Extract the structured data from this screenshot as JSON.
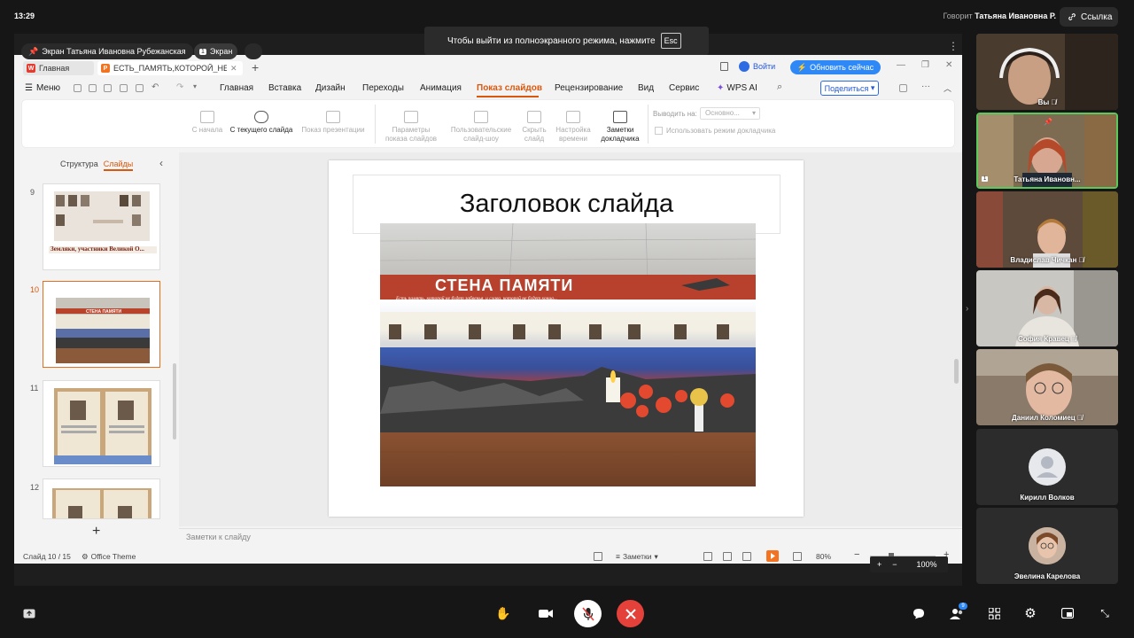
{
  "topbar": {
    "clock": "13:29",
    "speaking_label": "Говорит",
    "speaking_name": "Татьяна Ивановна Р.",
    "link_label": "Ссылка"
  },
  "share": {
    "presenter_label": "Экран Татьяна Ивановна Рубежанская",
    "screen_badge": "Экран",
    "screen_badge_num": "1",
    "fullscreen_tip": "Чтобы выйти из полноэкранного режима, нажмите",
    "fullscreen_key": "Esc"
  },
  "wps": {
    "tab_home": "Главная",
    "tab_doc": "ЕСТЬ_ПАМЯТЬ,КОТОРОЙ_НЕ",
    "login": "Войти",
    "update": "Обновить сейчас",
    "menu_label": "Меню",
    "menu": [
      "Главная",
      "Вставка",
      "Дизайн",
      "Переходы",
      "Анимация",
      "Показ слайдов",
      "Рецензирование",
      "Вид",
      "Сервис",
      "WPS AI"
    ],
    "share_btn": "Поделиться",
    "ribbon": {
      "from_start": "С начала",
      "from_current": "С текущего слайда",
      "present": "Показ презентации",
      "settings_1": "Параметры",
      "settings_2": "показа слайдов",
      "custom_1": "Пользовательские",
      "custom_2": "слайд-шоу",
      "hide_1": "Скрыть",
      "hide_2": "слайд",
      "timing_1": "Настройка",
      "timing_2": "времени",
      "notes_1": "Заметки",
      "notes_2": "докладчика",
      "output_label": "Выводить на:",
      "output_value": "Основно...",
      "presenter_mode": "Использовать режим докладчика"
    },
    "left_tabs": [
      "Структура",
      "Слайды"
    ],
    "thumbs": [
      {
        "num": "9",
        "caption": "Земляки, участники Великой О..."
      },
      {
        "num": "10",
        "caption": "СТЕНА ПАМЯТИ"
      },
      {
        "num": "11",
        "caption": ""
      },
      {
        "num": "12",
        "caption": ""
      }
    ],
    "add_slide": "+",
    "slide_title": "Заголовок слайда",
    "photo_banner": "СТЕНА ПАМЯТИ",
    "photo_motto": "Есть память, которой не будет забвенья, и слава, которой не будет конца...",
    "notes_placeholder": "Заметки к слайду",
    "status_slide": "Слайд 10 / 15",
    "status_theme": "Office Theme",
    "status_notes": "Заметки",
    "zoom": "80%",
    "zoom_overlay": "100%"
  },
  "participants": [
    {
      "name": "Вы",
      "bg": "#6b5a4a"
    },
    {
      "name": "Татьяна Ивановн...",
      "bg": "#7d6b52"
    },
    {
      "name": "Владислав Чичкан",
      "bg": "#5e4a3b"
    },
    {
      "name": "София Кравец",
      "bg": "#c9c7c2"
    },
    {
      "name": "Даниил Коломиец",
      "bg": "#8a7a6a"
    },
    {
      "name": "Кирилл Волков",
      "bg": "#2c2c2c"
    },
    {
      "name": "Эвелина Карелова",
      "bg": "#2c2c2c"
    }
  ],
  "participant_count": "9",
  "colors": {
    "accent": "#d9580e",
    "end_call": "#e4413b",
    "active_speaker": "#5bc95b",
    "wps_blue": "#2e89f6"
  }
}
